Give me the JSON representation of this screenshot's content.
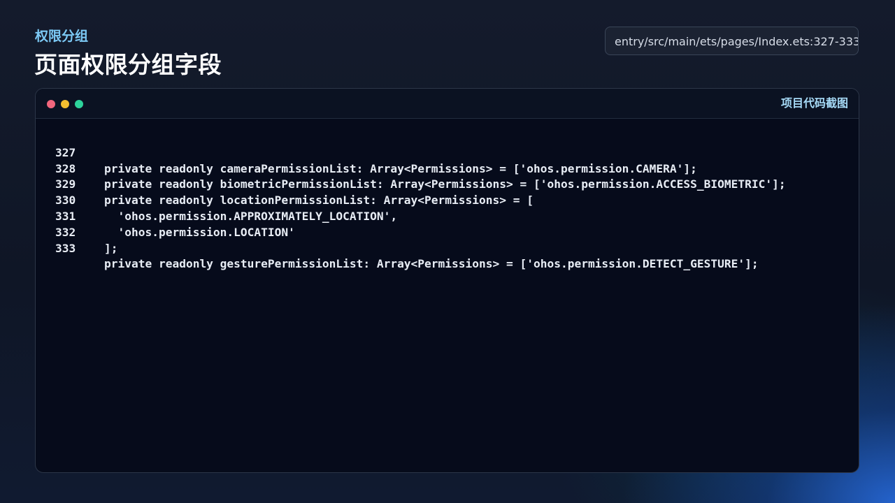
{
  "header": {
    "eyebrow": "权限分组",
    "title": "页面权限分组字段",
    "file_path": "entry/src/main/ets/pages/Index.ets:327-333"
  },
  "window": {
    "label": "项目代码截图",
    "controls": [
      "close-dot",
      "minimize-dot",
      "maximize-dot"
    ],
    "control_colors": [
      "#f2667d",
      "#f4be30",
      "#2dd39b"
    ]
  },
  "code": {
    "lines": [
      {
        "no": "327",
        "text": "private readonly cameraPermissionList: Array<Permissions> = ['ohos.permission.CAMERA'];"
      },
      {
        "no": "328",
        "text": "private readonly biometricPermissionList: Array<Permissions> = ['ohos.permission.ACCESS_BIOMETRIC'];"
      },
      {
        "no": "329",
        "text": "private readonly locationPermissionList: Array<Permissions> = ["
      },
      {
        "no": "330",
        "text": "  'ohos.permission.APPROXIMATELY_LOCATION',"
      },
      {
        "no": "331",
        "text": "  'ohos.permission.LOCATION'"
      },
      {
        "no": "332",
        "text": "];"
      },
      {
        "no": "333",
        "text": "private readonly gesturePermissionList: Array<Permissions> = ['ohos.permission.DETECT_GESTURE'];"
      }
    ]
  },
  "colors": {
    "accent": "#7cc9f5",
    "window_bg": "#060b1b"
  }
}
